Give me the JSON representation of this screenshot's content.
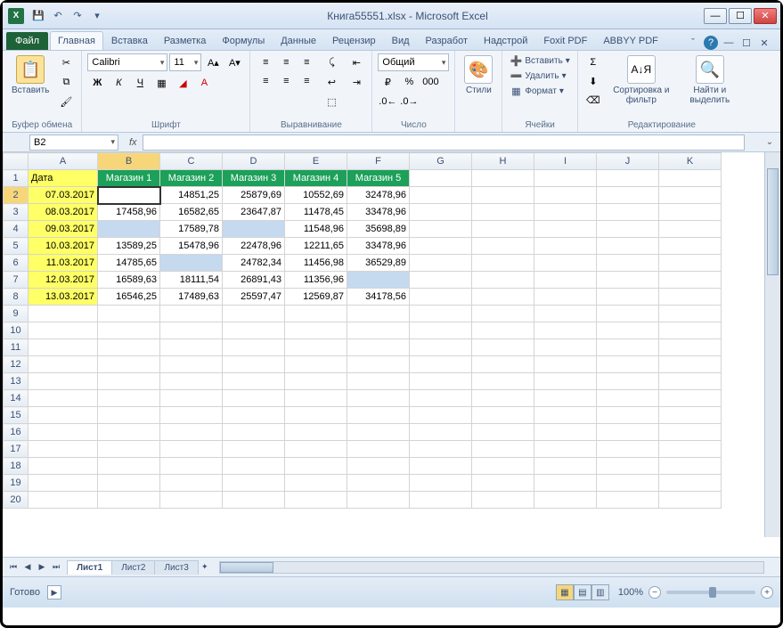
{
  "title": "Книга55551.xlsx - Microsoft Excel",
  "qat": {
    "save": "💾",
    "undo": "↶",
    "redo": "↷"
  },
  "tabs": {
    "file": "Файл",
    "items": [
      "Главная",
      "Вставка",
      "Разметка",
      "Формулы",
      "Данные",
      "Рецензир",
      "Вид",
      "Разработ",
      "Надстрой",
      "Foxit PDF",
      "ABBYY PDF"
    ],
    "active": 0
  },
  "ribbon": {
    "clipboard": {
      "paste": "Вставить",
      "label": "Буфер обмена"
    },
    "font": {
      "name": "Calibri",
      "size": "11",
      "label": "Шрифт"
    },
    "alignment": {
      "label": "Выравнивание"
    },
    "number": {
      "format": "Общий",
      "label": "Число"
    },
    "styles": {
      "btn": "Стили",
      "label": ""
    },
    "cells": {
      "insert": "Вставить",
      "delete": "Удалить",
      "format": "Формат",
      "label": "Ячейки"
    },
    "editing": {
      "sort": "Сортировка и фильтр",
      "find": "Найти и выделить",
      "label": "Редактирование"
    }
  },
  "namebox": "B2",
  "fx": "fx",
  "formula": "",
  "columns": [
    "A",
    "B",
    "C",
    "D",
    "E",
    "F",
    "G",
    "H",
    "I",
    "J",
    "K"
  ],
  "active_col_idx": 1,
  "active_row": 2,
  "rows_visible": 20,
  "headers": {
    "A": "Дата",
    "B": "Магазин 1",
    "C": "Магазин 2",
    "D": "Магазин 3",
    "E": "Магазин 4",
    "F": "Магазин 5"
  },
  "data_rows": [
    {
      "r": 2,
      "date": "07.03.2017",
      "B": "",
      "C": "14851,25",
      "D": "25879,69",
      "E": "10552,69",
      "F": "32478,96",
      "sel": [
        "B"
      ]
    },
    {
      "r": 3,
      "date": "08.03.2017",
      "B": "17458,96",
      "C": "16582,65",
      "D": "23647,87",
      "E": "11478,45",
      "F": "33478,96",
      "sel": []
    },
    {
      "r": 4,
      "date": "09.03.2017",
      "B": "",
      "C": "17589,78",
      "D": "",
      "E": "11548,96",
      "F": "35698,89",
      "sel": [
        "B",
        "D"
      ]
    },
    {
      "r": 5,
      "date": "10.03.2017",
      "B": "13589,25",
      "C": "15478,96",
      "D": "22478,96",
      "E": "12211,65",
      "F": "33478,96",
      "sel": []
    },
    {
      "r": 6,
      "date": "11.03.2017",
      "B": "14785,65",
      "C": "",
      "D": "24782,34",
      "E": "11456,98",
      "F": "36529,89",
      "sel": [
        "C"
      ]
    },
    {
      "r": 7,
      "date": "12.03.2017",
      "B": "16589,63",
      "C": "18111,54",
      "D": "26891,43",
      "E": "11356,96",
      "F": "",
      "sel": [
        "F"
      ]
    },
    {
      "r": 8,
      "date": "13.03.2017",
      "B": "16546,25",
      "C": "17489,63",
      "D": "25597,47",
      "E": "12569,87",
      "F": "34178,56",
      "sel": []
    }
  ],
  "sheets": {
    "items": [
      "Лист1",
      "Лист2",
      "Лист3"
    ],
    "active": 0
  },
  "status": {
    "ready": "Готово",
    "zoom": "100%"
  }
}
